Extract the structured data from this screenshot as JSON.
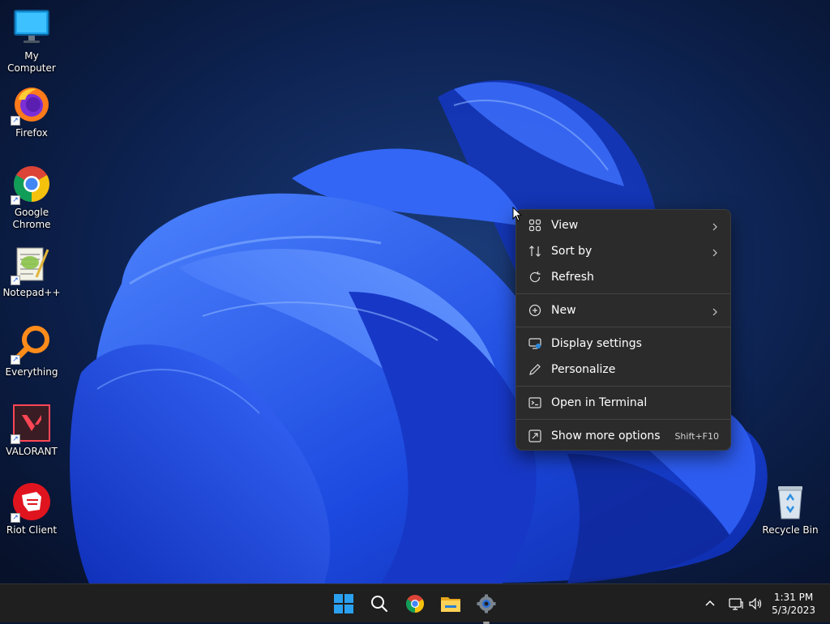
{
  "desktop": {
    "icons": [
      {
        "label": "My Computer",
        "icon": "monitor-icon",
        "shortcut": false
      },
      {
        "label": "Firefox",
        "icon": "firefox-icon",
        "shortcut": true
      },
      {
        "label": "Google Chrome",
        "icon": "chrome-icon",
        "shortcut": true
      },
      {
        "label": "Notepad++",
        "icon": "notepadpp-icon",
        "shortcut": true
      },
      {
        "label": "Everything",
        "icon": "everything-search-icon",
        "shortcut": true
      },
      {
        "label": "VALORANT",
        "icon": "valorant-icon",
        "shortcut": true
      },
      {
        "label": "Riot Client",
        "icon": "riot-client-icon",
        "shortcut": true
      },
      {
        "label": "Recycle Bin",
        "icon": "recycle-bin-icon",
        "shortcut": false
      }
    ]
  },
  "context_menu": {
    "items": [
      {
        "label": "View",
        "icon": "grid-view-icon",
        "submenu": true
      },
      {
        "label": "Sort by",
        "icon": "sort-icon",
        "submenu": true
      },
      {
        "label": "Refresh",
        "icon": "refresh-icon",
        "submenu": false
      },
      {
        "label": "New",
        "icon": "new-plus-icon",
        "submenu": true
      },
      {
        "label": "Display settings",
        "icon": "display-settings-icon",
        "submenu": false
      },
      {
        "label": "Personalize",
        "icon": "pen-icon",
        "submenu": false
      },
      {
        "label": "Open in Terminal",
        "icon": "terminal-icon",
        "submenu": false
      },
      {
        "label": "Show more options",
        "icon": "more-options-icon",
        "shortcut": "Shift+F10"
      }
    ]
  },
  "taskbar": {
    "pinned": [
      {
        "name": "Start",
        "icon": "windows-start-icon"
      },
      {
        "name": "Search",
        "icon": "search-icon"
      },
      {
        "name": "Google Chrome",
        "icon": "chrome-icon"
      },
      {
        "name": "File Explorer",
        "icon": "folder-icon"
      },
      {
        "name": "Settings",
        "icon": "settings-gear-icon",
        "active": true
      }
    ],
    "tray": {
      "icons": [
        "chevron-up-icon",
        "network-icon",
        "volume-icon"
      ],
      "time": "1:31 PM",
      "date": "5/3/2023"
    }
  },
  "colors": {
    "wallpaper_dark": "#0a1633",
    "bloom_blue": "#1f4fe0",
    "menu_bg": "#2b2b2b",
    "taskbar_bg": "#1f1f1f",
    "start_blue": "#2aa0f0"
  }
}
